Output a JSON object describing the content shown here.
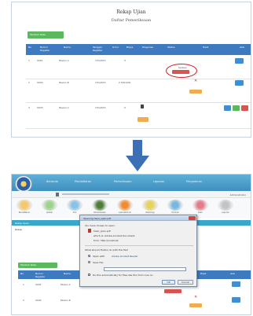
{
  "top_screen": {
    "title": "Rekap Ujian",
    "subtitle": "Daftar Pemeriksaan",
    "add_button_label": "Tambah Data",
    "columns": [
      "No",
      "Nomor Register",
      "Nama",
      "Tanggal Register",
      "Umur",
      "Biaya",
      "Diagnosa",
      "Status",
      "Hasil",
      "Aksi"
    ],
    "rows": [
      {
        "no": "1",
        "register": "0001",
        "name": "Pasien A",
        "date": "1/5/2015",
        "fee": "0",
        "status": "Selesai"
      },
      {
        "no": "2",
        "register": "0002",
        "name": "Pasien B",
        "date": "1/5/2015",
        "fee": "2.500.000",
        "status": ""
      },
      {
        "no": "3",
        "register": "0003",
        "name": "Pasien C",
        "date": "1/5/2015",
        "fee": "0",
        "status": ""
      }
    ]
  },
  "bottom_screen": {
    "header_links": [
      "Beranda",
      "Pendaftaran",
      "Pemeriksaan",
      "Laporan",
      "Pengaturan"
    ],
    "user_label": "Administrator",
    "icon_labels": [
      "Pendaftaran",
      "Jadwal",
      "Poli",
      "Pemeriksaan",
      "Laboratorium",
      "Radiologi",
      "Farmasi",
      "Kasir",
      "Laporan"
    ],
    "tab_label": "Rekap Ujian",
    "section_label": "Rekap",
    "add_button_label": "Tambah Data",
    "columns": [
      "No",
      "Nomor Register",
      "Nama",
      "Hasil",
      "Aksi"
    ],
    "rows": [
      {
        "no": "1",
        "register": "0001",
        "name": "Pasien A"
      },
      {
        "no": "2",
        "register": "0002",
        "name": "Pasien B"
      }
    ],
    "dialog": {
      "title": "Opening hasil_ujian.pdf",
      "intro": "You have chosen to open:",
      "file_name": "hasil_ujian.pdf",
      "file_type": "which is: Adobe Acrobat Document",
      "from": "from: http://localhost",
      "question": "What should Firefox do with this file?",
      "open_with_label": "Open with",
      "open_with_value": "Adobe Acrobat Reader",
      "save_label": "Save File",
      "remember_label": "Do this automatically for files like this from now on.",
      "ok_label": "OK",
      "cancel_label": "Cancel"
    }
  },
  "colors": {
    "table_header": "#3e7ac0",
    "header_bar": "#4a9fcc",
    "green_button": "#5cb85c",
    "highlight_ellipse": "#d21f2a",
    "arrow": "#3d6fb6"
  }
}
